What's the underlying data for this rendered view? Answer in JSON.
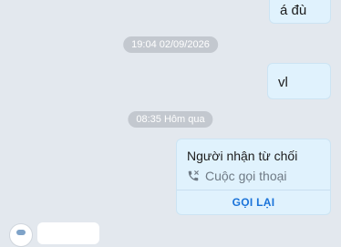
{
  "messages": [
    {
      "text": "á đù"
    },
    {
      "text": "vl"
    }
  ],
  "timestamps": [
    {
      "text": "19:04 02/09/2026"
    },
    {
      "text": "08:35 Hôm qua"
    }
  ],
  "call_card": {
    "title": "Người nhận từ chối",
    "subtitle": "Cuộc gọi thoại",
    "action": "GỌI LẠI",
    "icon": "phone-missed-icon"
  },
  "colors": {
    "background": "#e3e8ee",
    "outgoing_bubble": "#e0f2fd",
    "accent": "#1a73d9"
  }
}
